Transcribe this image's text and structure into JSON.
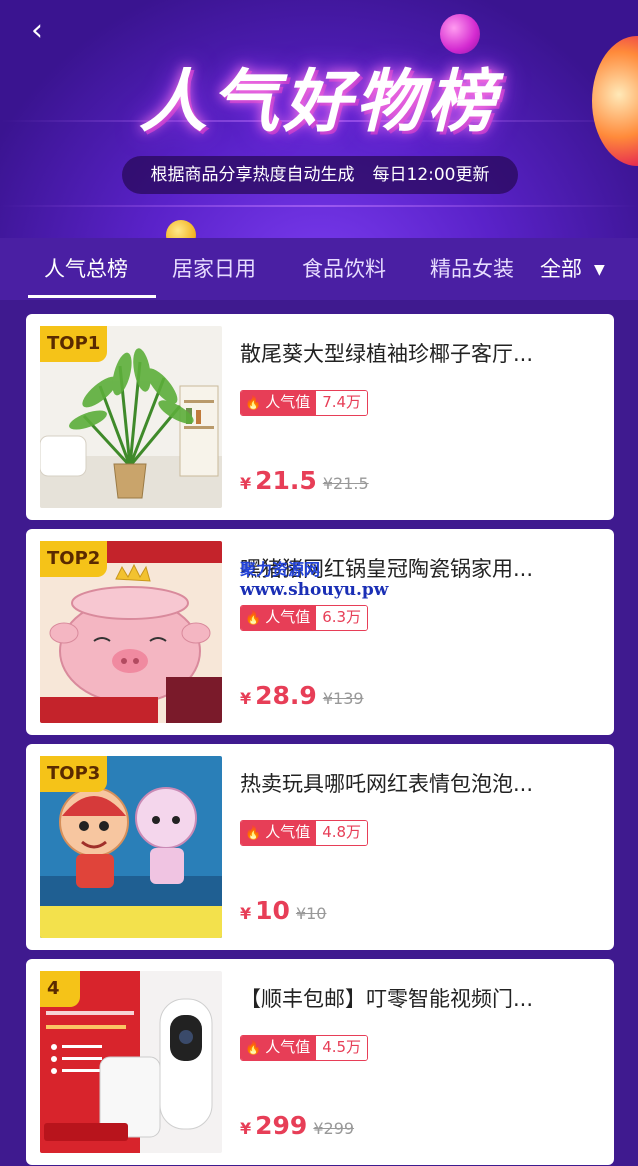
{
  "header": {
    "back_icon": "chevron-left-icon",
    "title": "人气好物榜",
    "subtitle_left": "根据商品分享热度自动生成",
    "subtitle_right": "每日12:00更新"
  },
  "tabs": [
    {
      "label": "人气总榜",
      "active": true
    },
    {
      "label": "居家日用",
      "active": false
    },
    {
      "label": "食品饮料",
      "active": false
    },
    {
      "label": "精品女装",
      "active": false
    }
  ],
  "tab_all": {
    "label": "全部",
    "icon": "caret-down-icon"
  },
  "heat_label": "人气值",
  "currency": "¥",
  "products": [
    {
      "rank": "TOP1",
      "title": "散尾葵大型绿植袖珍椰子客厅...",
      "heat": "7.4万",
      "price": "21.5",
      "original_price": "¥21.5"
    },
    {
      "rank": "TOP2",
      "title": "嘿猪猪网红锅皇冠陶瓷锅家用...",
      "heat": "6.3万",
      "price": "28.9",
      "original_price": "¥139"
    },
    {
      "rank": "TOP3",
      "title": "热卖玩具哪吒网红表情包泡泡...",
      "heat": "4.8万",
      "price": "10",
      "original_price": "¥10"
    },
    {
      "rank": "4",
      "title": "【顺丰包邮】叮零智能视频门...",
      "heat": "4.5万",
      "price": "299",
      "original_price": "¥299"
    }
  ],
  "watermark": {
    "line1": "聚力资源网",
    "line2": "www.shouyu.pw"
  },
  "colors": {
    "accent": "#e73e57",
    "banner": "#5a22c9",
    "rank_badge": "#f5c318"
  }
}
